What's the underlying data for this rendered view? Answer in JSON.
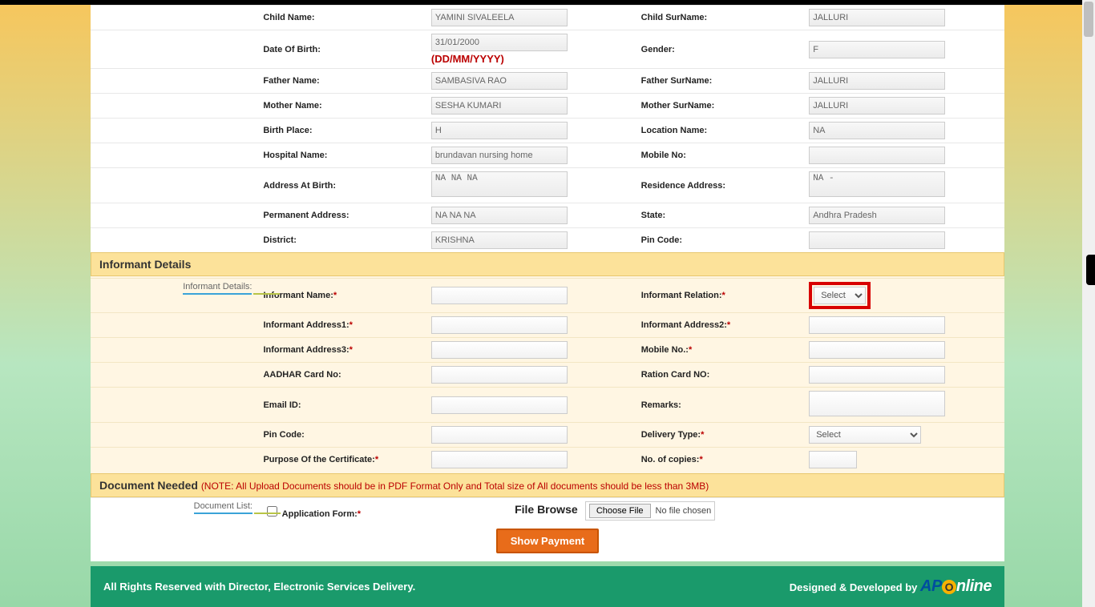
{
  "applicant": {
    "child_name_lbl": "Child Name:",
    "child_name": "YAMINI SIVALEELA",
    "child_surname_lbl": "Child SurName:",
    "child_surname": "JALLURI",
    "dob_lbl": "Date Of Birth:",
    "dob": "31/01/2000",
    "dob_hint": "(DD/MM/YYYY)",
    "gender_lbl": "Gender:",
    "gender": "F",
    "father_name_lbl": "Father Name:",
    "father_name": "SAMBASIVA RAO",
    "father_surname_lbl": "Father SurName:",
    "father_surname": "JALLURI",
    "mother_name_lbl": "Mother Name:",
    "mother_name": "SESHA KUMARI",
    "mother_surname_lbl": "Mother SurName:",
    "mother_surname": "JALLURI",
    "birth_place_lbl": "Birth Place:",
    "birth_place": "H",
    "location_name_lbl": "Location Name:",
    "location_name": "NA",
    "hospital_name_lbl": "Hospital Name:",
    "hospital_name": "brundavan nursing home",
    "mobile_no_lbl": "Mobile No:",
    "mobile_no": "",
    "address_birth_lbl": "Address At Birth:",
    "address_birth": "NA NA NA",
    "residence_address_lbl": "Residence Address:",
    "residence_address": "NA -",
    "permanent_address_lbl": "Permanent Address:",
    "permanent_address": "NA NA NA",
    "state_lbl": "State:",
    "state": "Andhra Pradesh",
    "district_lbl": "District:",
    "district": "KRISHNA",
    "pin_lbl": "Pin Code:",
    "pin": ""
  },
  "informant": {
    "section_title": "Informant Details",
    "side_label": "Informant Details:",
    "name_lbl": "Informant Name:",
    "relation_lbl": "Informant Relation:",
    "relation_value": "Select",
    "addr1_lbl": "Informant Address1:",
    "addr2_lbl": "Informant Address2:",
    "addr3_lbl": "Informant Address3:",
    "mob_lbl": "Mobile No.:",
    "aadhar_lbl": "AADHAR Card No:",
    "ration_lbl": "Ration Card NO:",
    "email_lbl": "Email ID:",
    "remarks_lbl": "Remarks:",
    "pin_lbl": "Pin Code:",
    "delivery_lbl": "Delivery Type:",
    "delivery_value": "Select",
    "purpose_lbl": "Purpose Of the Certificate:",
    "copies_lbl": "No. of copies:"
  },
  "documents": {
    "section_title": "Document Needed",
    "note": "(NOTE: All Upload Documents should be in PDF Format Only and Total size of All documents should be less than 3MB)",
    "side_label": "Document List:",
    "appform_lbl": "Application Form:",
    "file_browse_lbl": "File Browse",
    "choose_btn": "Choose File",
    "no_file": "No file chosen"
  },
  "buttons": {
    "show_payment": "Show Payment"
  },
  "footer": {
    "left": "All Rights Reserved with Director, Electronic Services Delivery.",
    "right": "Designed & Developed by",
    "logo_ap": "AP",
    "logo_o": "O",
    "logo_nline": "nline"
  }
}
